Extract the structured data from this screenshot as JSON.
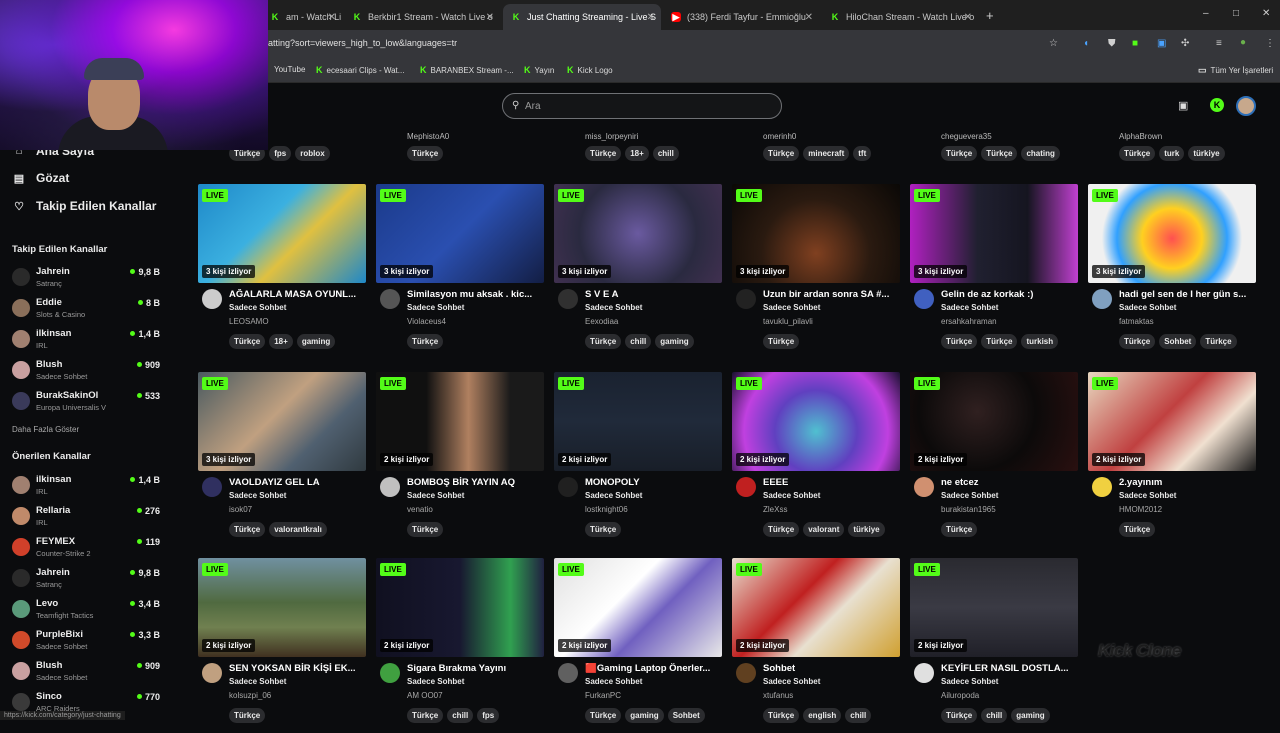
{
  "browser": {
    "tabs": [
      {
        "label": "am - Watch Li",
        "icon": "kick-icon"
      },
      {
        "label": "Berkbir1 Stream - Watch Live o",
        "icon": "kick-icon"
      },
      {
        "label": "Just Chatting Streaming - Live S",
        "icon": "kick-icon",
        "active": true
      },
      {
        "label": "(338) Ferdi Tayfur - Emmioğlu",
        "icon": "youtube-icon"
      },
      {
        "label": "HiloChan Stream - Watch Live o",
        "icon": "kick-icon"
      }
    ],
    "new_tab": "+",
    "url": "atting?sort=viewers_high_to_low&languages=tr",
    "bookmarks": [
      "YouTube",
      "ecesaari Clips - Wat...",
      "BARANBEX Stream -...",
      "Yayın",
      "Kick Logo"
    ],
    "all_bookmarks": "Tüm Yer İşaretleri",
    "window_controls": [
      "–",
      "□",
      "✕"
    ]
  },
  "search": {
    "placeholder": "Ara"
  },
  "sidebar": {
    "nav": [
      {
        "label": "Ana Sayfa",
        "icon": "home-icon"
      },
      {
        "label": "Gözat",
        "icon": "browse-icon"
      },
      {
        "label": "Takip Edilen Kanallar",
        "icon": "heart-icon"
      }
    ],
    "followed_title": "Takip Edilen Kanallar",
    "followed": [
      {
        "name": "Jahrein",
        "category": "Satranç",
        "viewers": "9,8 B",
        "color": "#2a2a2a"
      },
      {
        "name": "Eddie",
        "category": "Slots & Casino",
        "viewers": "8 B",
        "color": "#8a6f5a"
      },
      {
        "name": "ilkinsan",
        "category": "IRL",
        "viewers": "1,4 B",
        "color": "#a08070"
      },
      {
        "name": "Blush",
        "category": "Sadece Sohbet",
        "viewers": "909",
        "color": "#c9a0a0"
      },
      {
        "name": "BurakSakinOl",
        "category": "Europa Universalis V",
        "viewers": "533",
        "color": "#3a3a5a"
      }
    ],
    "more": "Daha Fazla Göster",
    "recommended_title": "Önerilen Kanallar",
    "recommended": [
      {
        "name": "ilkinsan",
        "category": "IRL",
        "viewers": "1,4 B",
        "color": "#a08070"
      },
      {
        "name": "Rellaria",
        "category": "IRL",
        "viewers": "276",
        "color": "#c08a6a"
      },
      {
        "name": "FEYMEX",
        "category": "Counter-Strike 2",
        "viewers": "119",
        "color": "#d0402a"
      },
      {
        "name": "Jahrein",
        "category": "Satranç",
        "viewers": "9,8 B",
        "color": "#2a2a2a"
      },
      {
        "name": "Levo",
        "category": "Teamfight Tactics",
        "viewers": "3,4 B",
        "color": "#5a9a7a"
      },
      {
        "name": "PurpleBixi",
        "category": "Sadece Sohbet",
        "viewers": "3,3 B",
        "color": "#d04a2a"
      },
      {
        "name": "Blush",
        "category": "Sadece Sohbet",
        "viewers": "909",
        "color": "#c9a0a0"
      },
      {
        "name": "Sinco",
        "category": "ARC Raiders",
        "viewers": "770",
        "color": "#3a3a3a"
      }
    ]
  },
  "status_url": "https://kick.com/category/just-chatting",
  "top_row": [
    {
      "name": "",
      "tags": [
        "Türkçe",
        "fps",
        "roblox"
      ]
    },
    {
      "name": "MephistoA0",
      "tags": [
        "Türkçe"
      ]
    },
    {
      "name": "miss_lorpeyniri",
      "tags": [
        "Türkçe",
        "18+",
        "chill"
      ]
    },
    {
      "name": "omerinh0",
      "tags": [
        "Türkçe",
        "minecraft",
        "tft"
      ]
    },
    {
      "name": "cheguevera35",
      "tags": [
        "Türkçe",
        "Türkçe",
        "chating"
      ]
    },
    {
      "name": "AlphaBrown",
      "tags": [
        "Türkçe",
        "turk",
        "türkiye"
      ]
    }
  ],
  "live_badge": "LIVE",
  "streams": [
    {
      "viewers": "3 kişi izliyor",
      "title": "AĞALARLA MASA OYUNL...",
      "category": "Sadece Sohbet",
      "channel": "LEOSAMO",
      "tags": [
        "Türkçe",
        "18+",
        "gaming"
      ]
    },
    {
      "viewers": "3 kişi izliyor",
      "title": "Similasyon mu aksak . kic...",
      "category": "Sadece Sohbet",
      "channel": "Violaceus4",
      "tags": [
        "Türkçe"
      ]
    },
    {
      "viewers": "3 kişi izliyor",
      "title": "S V E A",
      "category": "Sadece Sohbet",
      "channel": "Eexodiaa",
      "tags": [
        "Türkçe",
        "chill",
        "gaming"
      ]
    },
    {
      "viewers": "3 kişi izliyor",
      "title": "Uzun bir ardan sonra SA #...",
      "category": "Sadece Sohbet",
      "channel": "tavuklu_pilavli",
      "tags": [
        "Türkçe"
      ]
    },
    {
      "viewers": "3 kişi izliyor",
      "title": "Gelin de az korkak :)",
      "category": "Sadece Sohbet",
      "channel": "ersahkahraman",
      "tags": [
        "Türkçe",
        "Türkçe",
        "turkish"
      ]
    },
    {
      "viewers": "3 kişi izliyor",
      "title": "hadi gel sen de I her gün s...",
      "category": "Sadece Sohbet",
      "channel": "fatmaktas",
      "tags": [
        "Türkçe",
        "Sohbet",
        "Türkçe"
      ]
    },
    {
      "viewers": "3 kişi izliyor",
      "title": "VAOLDAYIZ GEL LA",
      "category": "Sadece Sohbet",
      "channel": "isok07",
      "tags": [
        "Türkçe",
        "valorantkralı"
      ]
    },
    {
      "viewers": "2 kişi izliyor",
      "title": "BOMBOŞ BİR YAYIN AQ",
      "category": "Sadece Sohbet",
      "channel": "venatio",
      "tags": [
        "Türkçe"
      ]
    },
    {
      "viewers": "2 kişi izliyor",
      "title": "MONOPOLY",
      "category": "Sadece Sohbet",
      "channel": "lostknight06",
      "tags": [
        "Türkçe"
      ]
    },
    {
      "viewers": "2 kişi izliyor",
      "title": "EEEE",
      "category": "Sadece Sohbet",
      "channel": "ZleXss",
      "tags": [
        "Türkçe",
        "valorant",
        "türkiye"
      ]
    },
    {
      "viewers": "2 kişi izliyor",
      "title": "ne etcez",
      "category": "Sadece Sohbet",
      "channel": "burakistan1965",
      "tags": [
        "Türkçe"
      ]
    },
    {
      "viewers": "2 kişi izliyor",
      "title": "2.yayınım",
      "category": "Sadece Sohbet",
      "channel": "HMOM2012",
      "tags": [
        "Türkçe"
      ]
    },
    {
      "viewers": "2 kişi izliyor",
      "title": "SEN YOKSAN BİR KİŞİ EK...",
      "category": "Sadece Sohbet",
      "channel": "kolsuzpi_06",
      "tags": [
        "Türkçe"
      ]
    },
    {
      "viewers": "2 kişi izliyor",
      "title": "Sigara Bırakma Yayını",
      "category": "Sadece Sohbet",
      "channel": "AM  OO07",
      "tags": [
        "Türkçe",
        "chill",
        "fps"
      ]
    },
    {
      "viewers": "2 kişi izliyor",
      "title": "🟥Gaming Laptop Önerler...",
      "category": "Sadece Sohbet",
      "channel": "FurkanPC",
      "tags": [
        "Türkçe",
        "gaming",
        "Sohbet"
      ]
    },
    {
      "viewers": "2 kişi izliyor",
      "title": "Sohbet",
      "category": "Sadece Sohbet",
      "channel": "xtufanus",
      "tags": [
        "Türkçe",
        "english",
        "chill"
      ]
    },
    {
      "viewers": "2 kişi izliyor",
      "title": "KEYİFLER NASIL DOSTLA...",
      "category": "Sadece Sohbet",
      "channel": "Ailuropoda",
      "tags": [
        "Türkçe",
        "chill",
        "gaming"
      ]
    }
  ],
  "watermark": "Kick Clone"
}
